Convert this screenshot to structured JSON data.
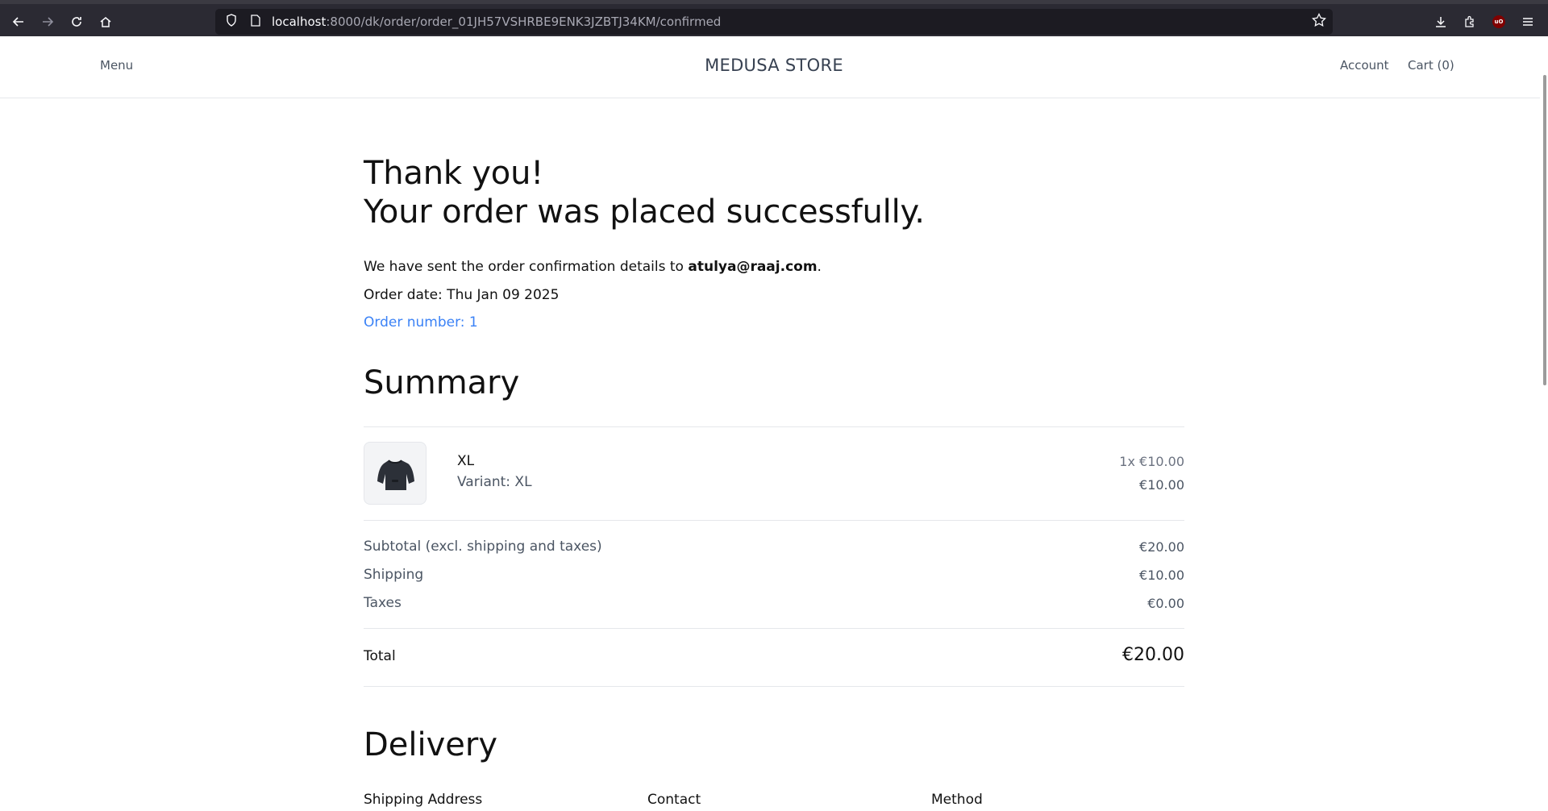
{
  "browser": {
    "url_host": "localhost",
    "url_path": ":8000/dk/order/order_01JH57VSHRBE9ENK3JZBTJ34KM/confirmed",
    "icons": [
      "back-icon",
      "forward-icon",
      "reload-icon",
      "home-icon",
      "shield-icon",
      "page-icon",
      "bookmark-star-icon",
      "download-icon",
      "extensions-icon",
      "ublock-icon",
      "hamburger-menu-icon"
    ],
    "ublock_badge": "uO"
  },
  "header": {
    "menu_label": "Menu",
    "store_title": "MEDUSA STORE",
    "account_label": "Account",
    "cart_label": "Cart (0)"
  },
  "confirmation": {
    "heading_line1": "Thank you!",
    "heading_line2": "Your order was placed successfully.",
    "sent_prefix": "We have sent the order confirmation details to ",
    "email": "atulya@raaj.com",
    "sent_suffix": ".",
    "order_date": "Order date: Thu Jan 09 2025",
    "order_number": "Order number: 1"
  },
  "summary": {
    "heading": "Summary",
    "items": [
      {
        "title": "XL",
        "variant": "Variant: XL",
        "quantity": "1x",
        "unit_price": "€10.00",
        "total": "€10.00",
        "thumbnail": "sweatshirt-image"
      }
    ],
    "subtotal_label": "Subtotal (excl. shipping and taxes)",
    "subtotal_value": "€20.00",
    "shipping_label": "Shipping",
    "shipping_value": "€10.00",
    "taxes_label": "Taxes",
    "taxes_value": "€0.00",
    "total_label": "Total",
    "total_value": "€20.00"
  },
  "delivery": {
    "heading": "Delivery",
    "columns": [
      "Shipping Address",
      "Contact",
      "Method"
    ]
  },
  "colors": {
    "link_blue": "#3b82f6",
    "chrome_bg": "#2b2a33",
    "urlbar_bg": "#1c1b22"
  }
}
